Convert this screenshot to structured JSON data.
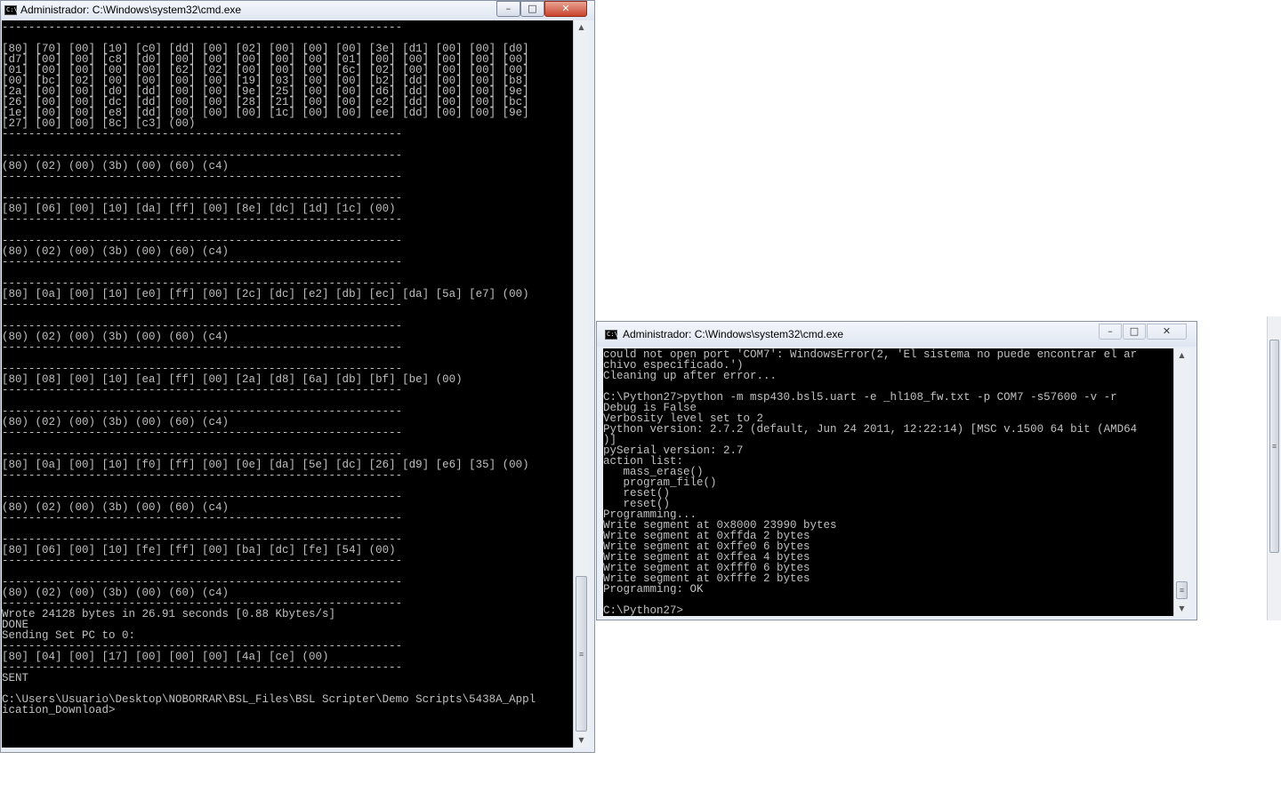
{
  "left_window": {
    "title": "Administrador: C:\\Windows\\system32\\cmd.exe",
    "icon_label": "C:\\",
    "controls": {
      "minimize": "–",
      "maximize": "□",
      "close": "✕"
    },
    "output": "------------------------------------------------------------\n\n[80] [70] [00] [10] [c0] [dd] [00] [02] [00] [00] [00] [3e] [d1] [00] [00] [d0]\n[d7] [00] [00] [c8] [d0] [00] [00] [00] [00] [00] [01] [00] [00] [00] [00] [00]\n[01] [00] [00] [00] [00] [62] [02] [00] [00] [00] [6c] [02] [00] [00] [00] [00]\n[00] [bc] [02] [00] [00] [00] [00] [19] [03] [00] [00] [b2] [dd] [00] [00] [b8]\n[2a] [00] [00] [d0] [dd] [00] [00] [9e] [25] [00] [00] [d6] [dd] [00] [00] [9e]\n[26] [00] [00] [dc] [dd] [00] [00] [28] [21] [00] [00] [e2] [dd] [00] [00] [bc]\n[1e] [00] [00] [e8] [dd] [00] [00] [00] [1c] [00] [00] [ee] [dd] [00] [00] [9e]\n[27] [00] [00] [8c] [c3] (00)\n------------------------------------------------------------\n\n------------------------------------------------------------\n(80) (02) (00) (3b) (00) (60) (c4)\n------------------------------------------------------------\n\n------------------------------------------------------------\n[80] [06] [00] [10] [da] [ff] [00] [8e] [dc] [1d] [1c] (00)\n------------------------------------------------------------\n\n------------------------------------------------------------\n(80) (02) (00) (3b) (00) (60) (c4)\n------------------------------------------------------------\n\n------------------------------------------------------------\n[80] [0a] [00] [10] [e0] [ff] [00] [2c] [dc] [e2] [db] [ec] [da] [5a] [e7] (00)\n------------------------------------------------------------\n\n------------------------------------------------------------\n(80) (02) (00) (3b) (00) (60) (c4)\n------------------------------------------------------------\n\n------------------------------------------------------------\n[80] [08] [00] [10] [ea] [ff] [00] [2a] [d8] [6a] [db] [bf] [be] (00)\n------------------------------------------------------------\n\n------------------------------------------------------------\n(80) (02) (00) (3b) (00) (60) (c4)\n------------------------------------------------------------\n\n------------------------------------------------------------\n[80] [0a] [00] [10] [f0] [ff] [00] [0e] [da] [5e] [dc] [26] [d9] [e6] [35] (00)\n------------------------------------------------------------\n\n------------------------------------------------------------\n(80) (02) (00) (3b) (00) (60) (c4)\n------------------------------------------------------------\n\n------------------------------------------------------------\n[80] [06] [00] [10] [fe] [ff] [00] [ba] [dc] [fe] [54] (00)\n------------------------------------------------------------\n\n------------------------------------------------------------\n(80) (02) (00) (3b) (00) (60) (c4)\n------------------------------------------------------------\nWrote 24128 bytes in 26.91 seconds [0.88 Kbytes/s]\nDONE\nSending Set PC to 0:\n------------------------------------------------------------\n[80] [04] [00] [17] [00] [00] [00] [4a] [ce] (00)\n------------------------------------------------------------\nSENT\n\nC:\\Users\\Usuario\\Desktop\\NOBORRAR\\BSL_Files\\BSL Scripter\\Demo Scripts\\5438A_Appl\nication_Download>",
    "scrollbar": {
      "up": "▲",
      "down": "▼",
      "grip": "≡"
    }
  },
  "right_window": {
    "title": "Administrador: C:\\Windows\\system32\\cmd.exe",
    "icon_label": "C:\\",
    "controls": {
      "minimize": "–",
      "maximize": "□",
      "close": "✕"
    },
    "output": "could not open port 'COM7': WindowsError(2, 'El sistema no puede encontrar el ar\nchivo especificado.')\nCleaning up after error...\n\nC:\\Python27>python -m msp430.bsl5.uart -e _hl108_fw.txt -p COM7 -s57600 -v -r\nDebug is False\nVerbosity level set to 2\nPython version: 2.7.2 (default, Jun 24 2011, 12:22:14) [MSC v.1500 64 bit (AMD64\n)]\npySerial version: 2.7\naction list:\n   mass_erase()\n   program_file()\n   reset()\n   reset()\nProgramming...\nWrite segment at 0x8000 23990 bytes\nWrite segment at 0xffda 2 bytes\nWrite segment at 0xffe0 6 bytes\nWrite segment at 0xffea 4 bytes\nWrite segment at 0xfff0 6 bytes\nWrite segment at 0xfffe 2 bytes\nProgramming: OK\n\nC:\\Python27>",
    "scrollbar": {
      "up": "▲",
      "down": "▼",
      "grip": "≡"
    }
  },
  "desktop_scrollbar": {
    "grip": "≡"
  }
}
